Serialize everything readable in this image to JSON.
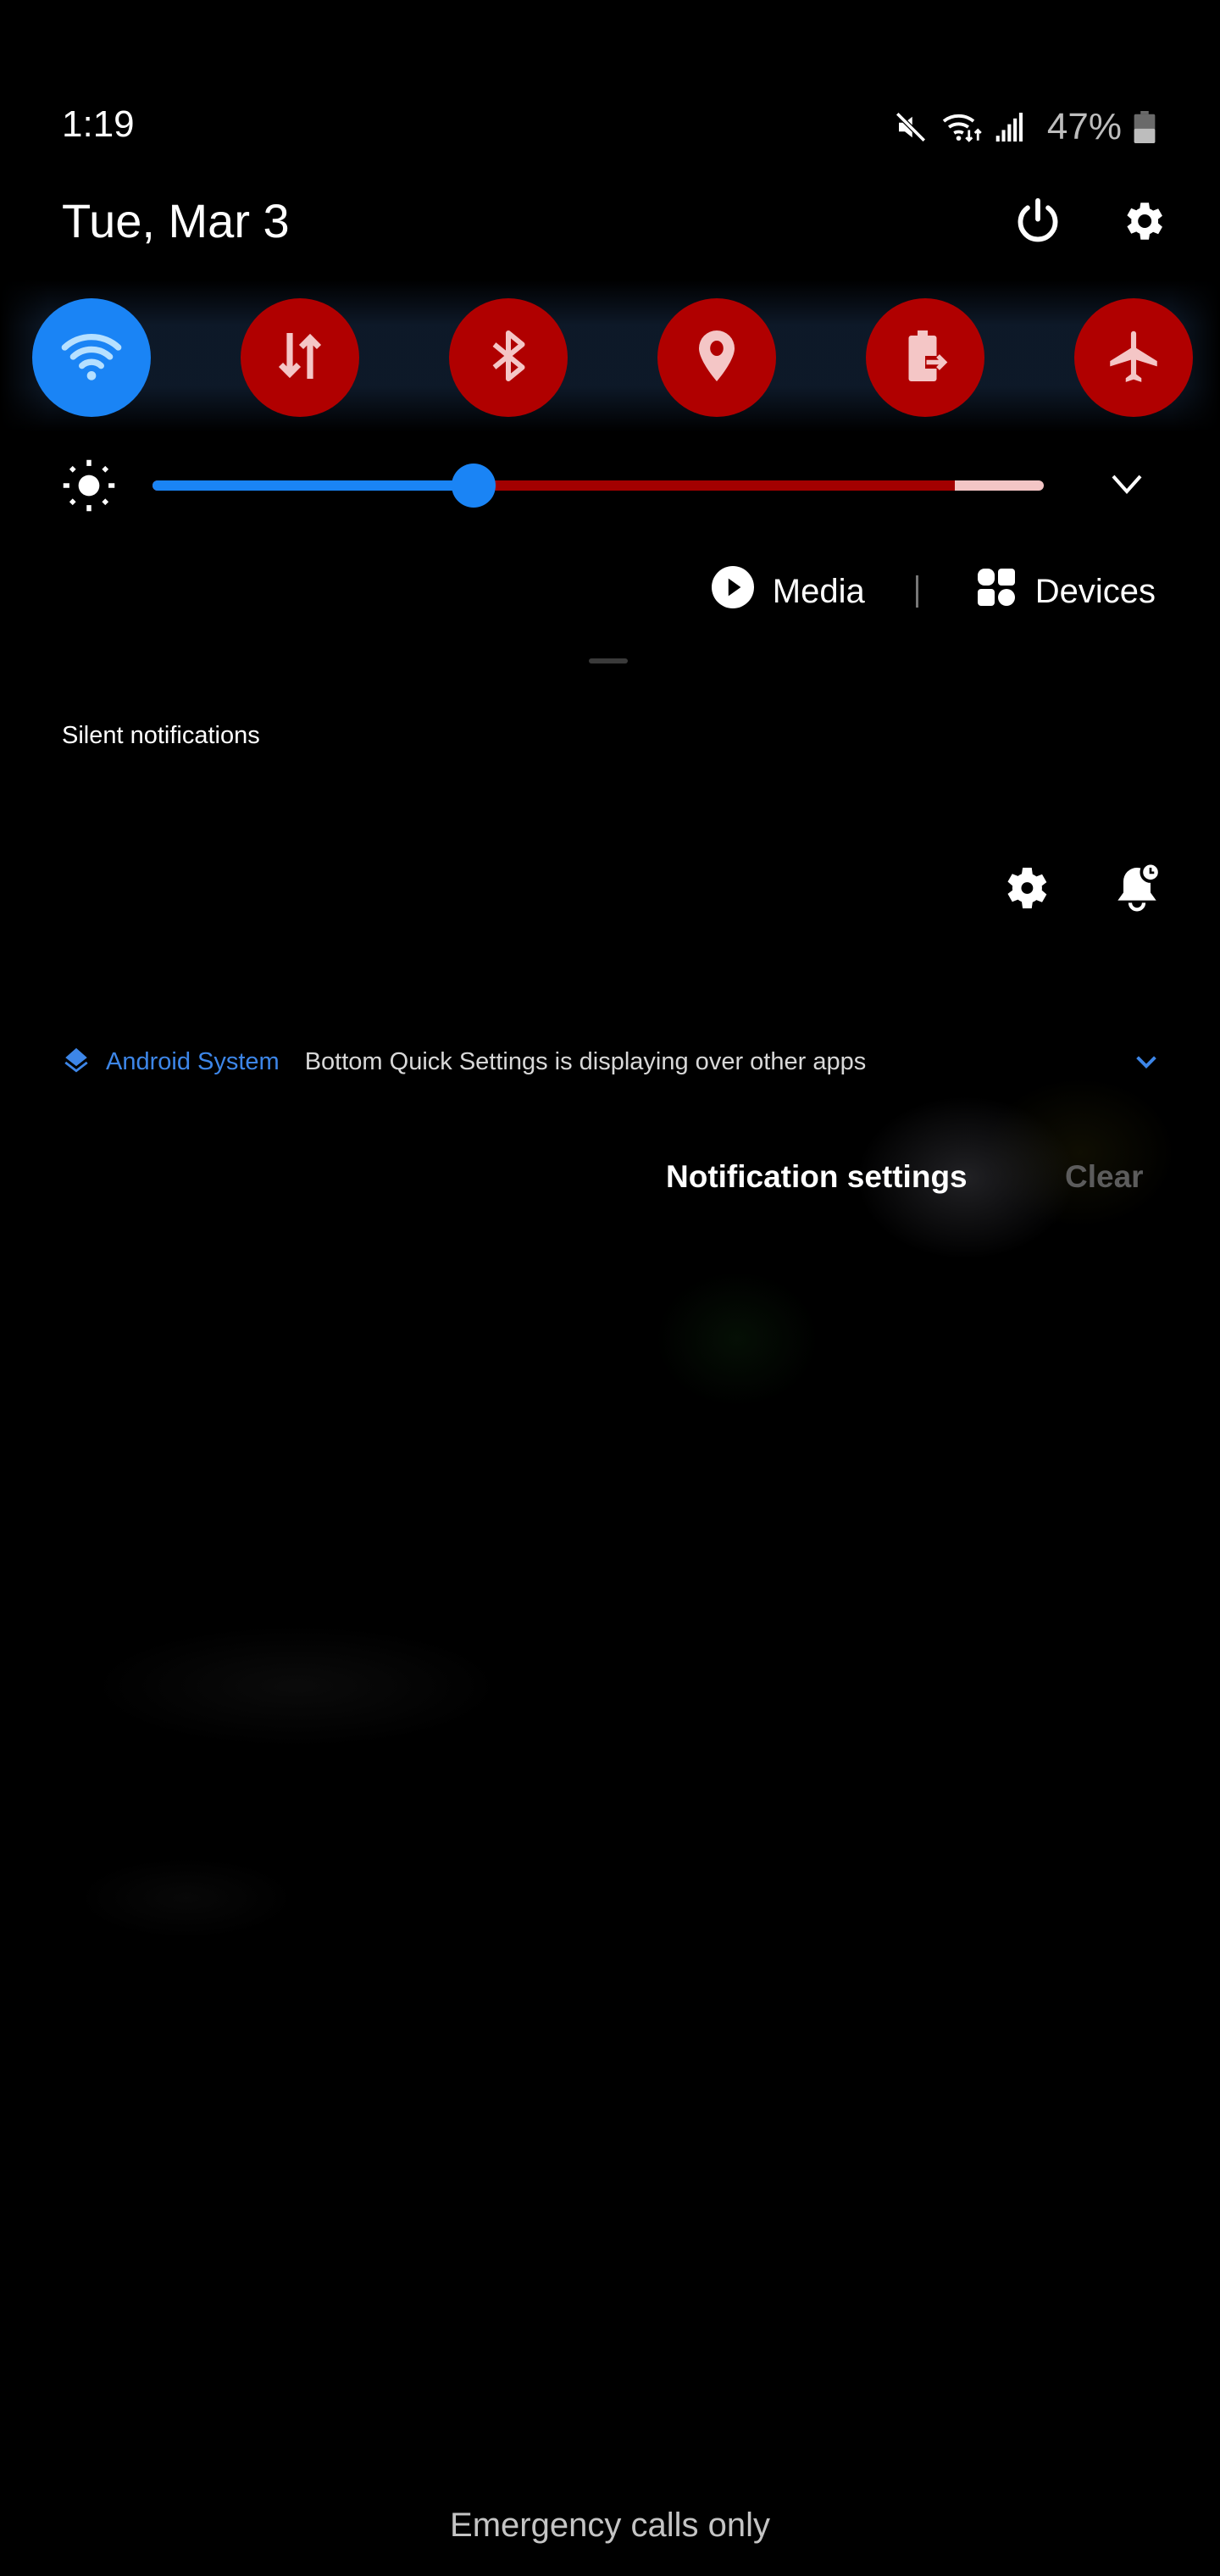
{
  "status_bar": {
    "time": "1:19",
    "icons": [
      "mute-icon",
      "wifi-data-icon",
      "cell-signal-icon",
      "battery-icon"
    ],
    "battery_percent": "47%",
    "battery_level": 0.47
  },
  "header": {
    "date": "Tue, Mar 3",
    "power_icon": "power-icon",
    "settings_icon": "gear-icon"
  },
  "quick_toggles": [
    {
      "name": "Wi-Fi",
      "icon": "wifi-icon",
      "state": "on",
      "color": "#1a84f5",
      "icon_color": "#b6e0ff"
    },
    {
      "name": "Mobile data",
      "icon": "data-arrows-icon",
      "state": "off",
      "color": "#b00000",
      "icon_color": "#f4c6c6"
    },
    {
      "name": "Bluetooth",
      "icon": "bluetooth-icon",
      "state": "off",
      "color": "#b00000",
      "icon_color": "#f4c6c6"
    },
    {
      "name": "Location",
      "icon": "location-pin-icon",
      "state": "off",
      "color": "#b00000",
      "icon_color": "#f4c6c6"
    },
    {
      "name": "Power saving",
      "icon": "battery-share-icon",
      "state": "off",
      "color": "#b00000",
      "icon_color": "#f4c6c6"
    },
    {
      "name": "Airplane mode",
      "icon": "airplane-icon",
      "state": "off",
      "color": "#b00000",
      "icon_color": "#f4c6c6"
    }
  ],
  "brightness": {
    "icon": "sun-icon",
    "level": 0.36,
    "secondary_level": 0.9,
    "fill_color": "#1a84f5",
    "secondary_color": "#a30000",
    "track_color": "#f3c5c5",
    "expand_icon": "chevron-down-icon"
  },
  "media_devices": {
    "media_label": "Media",
    "media_icon": "play-circle-icon",
    "devices_label": "Devices",
    "devices_icon": "devices-grid-icon"
  },
  "notifications": {
    "section_label": "Silent notifications",
    "section_icons": [
      "gear-icon",
      "bell-snooze-icon"
    ],
    "items": [
      {
        "app": "Android System",
        "app_icon": "layers-icon",
        "text": "Bottom Quick Settings is displaying over other apps",
        "expand_icon": "chevron-down-icon",
        "accent": "#3d86e8"
      }
    ],
    "settings_label": "Notification settings",
    "clear_label": "Clear"
  },
  "footer": {
    "carrier_text": "Emergency calls only"
  }
}
